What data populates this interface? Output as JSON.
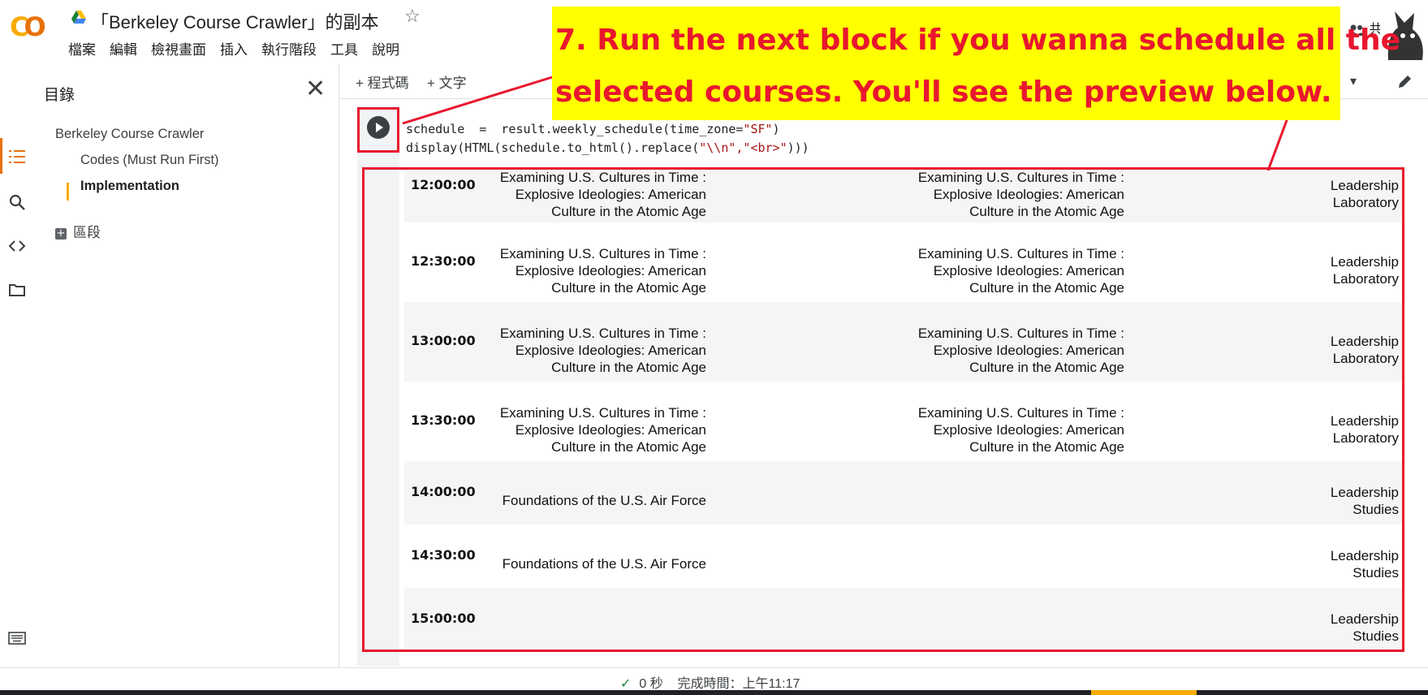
{
  "app": {
    "logo_text": "CO",
    "doc_title": "「Berkeley Course Crawler」的副本",
    "share_label": "共用"
  },
  "menu": [
    "檔案",
    "編輯",
    "檢視畫面",
    "插入",
    "執行階段",
    "工具",
    "說明"
  ],
  "toolbar": {
    "add_code": "+ 程式碼",
    "add_text": "+ 文字"
  },
  "sidebar": {
    "title": "目錄",
    "items": [
      "Berkeley Course Crawler",
      "Codes (Must Run First)",
      "Implementation"
    ],
    "add_section": "區段"
  },
  "cell": {
    "code_line1_a": "schedule  =  result.weekly_schedule(time_zone=",
    "code_line1_str": "\"SF\"",
    "code_line1_b": ")",
    "code_line2_a": "display(HTML(schedule.to_html().replace(",
    "code_line2_str": "\"\\\\n\",\"<br>\"",
    "code_line2_b": ")))"
  },
  "schedule": [
    {
      "time": "12:00:00",
      "col1": "Examining U.S. Cultures in Time : Explosive Ideologies: American Culture in the Atomic Age",
      "col2": "Examining U.S. Cultures in Time : Explosive Ideologies: American Culture in the Atomic Age",
      "col3": "Leadership Laboratory"
    },
    {
      "time": "12:30:00",
      "col1": "Examining U.S. Cultures in Time : Explosive Ideologies: American Culture in the Atomic Age",
      "col2": "Examining U.S. Cultures in Time : Explosive Ideologies: American Culture in the Atomic Age",
      "col3": "Leadership Laboratory"
    },
    {
      "time": "13:00:00",
      "col1": "Examining U.S. Cultures in Time : Explosive Ideologies: American Culture in the Atomic Age",
      "col2": "Examining U.S. Cultures in Time : Explosive Ideologies: American Culture in the Atomic Age",
      "col3": "Leadership Laboratory"
    },
    {
      "time": "13:30:00",
      "col1": "Examining U.S. Cultures in Time : Explosive Ideologies: American Culture in the Atomic Age",
      "col2": "Examining U.S. Cultures in Time : Explosive Ideologies: American Culture in the Atomic Age",
      "col3": "Leadership Laboratory"
    },
    {
      "time": "14:00:00",
      "col1": "Foundations of the U.S. Air Force",
      "col2": "",
      "col3": "Leadership Studies"
    },
    {
      "time": "14:30:00",
      "col1": "Foundations of the U.S. Air Force",
      "col2": "",
      "col3": "Leadership Studies"
    },
    {
      "time": "15:00:00",
      "col1": "",
      "col2": "",
      "col3": "Leadership Studies"
    }
  ],
  "callout": {
    "line1": "7. Run the next block if you wanna schedule all the",
    "line2": "selected courses. You'll see the preview below."
  },
  "status": {
    "duration": "0 秒",
    "completed": "完成時間：上午11:17"
  },
  "colors": {
    "accent_orange": "#e8710a",
    "accent_yellow": "#f9ab00",
    "annotation_red": "#e8172e",
    "callout_bg": "#ffff00"
  }
}
